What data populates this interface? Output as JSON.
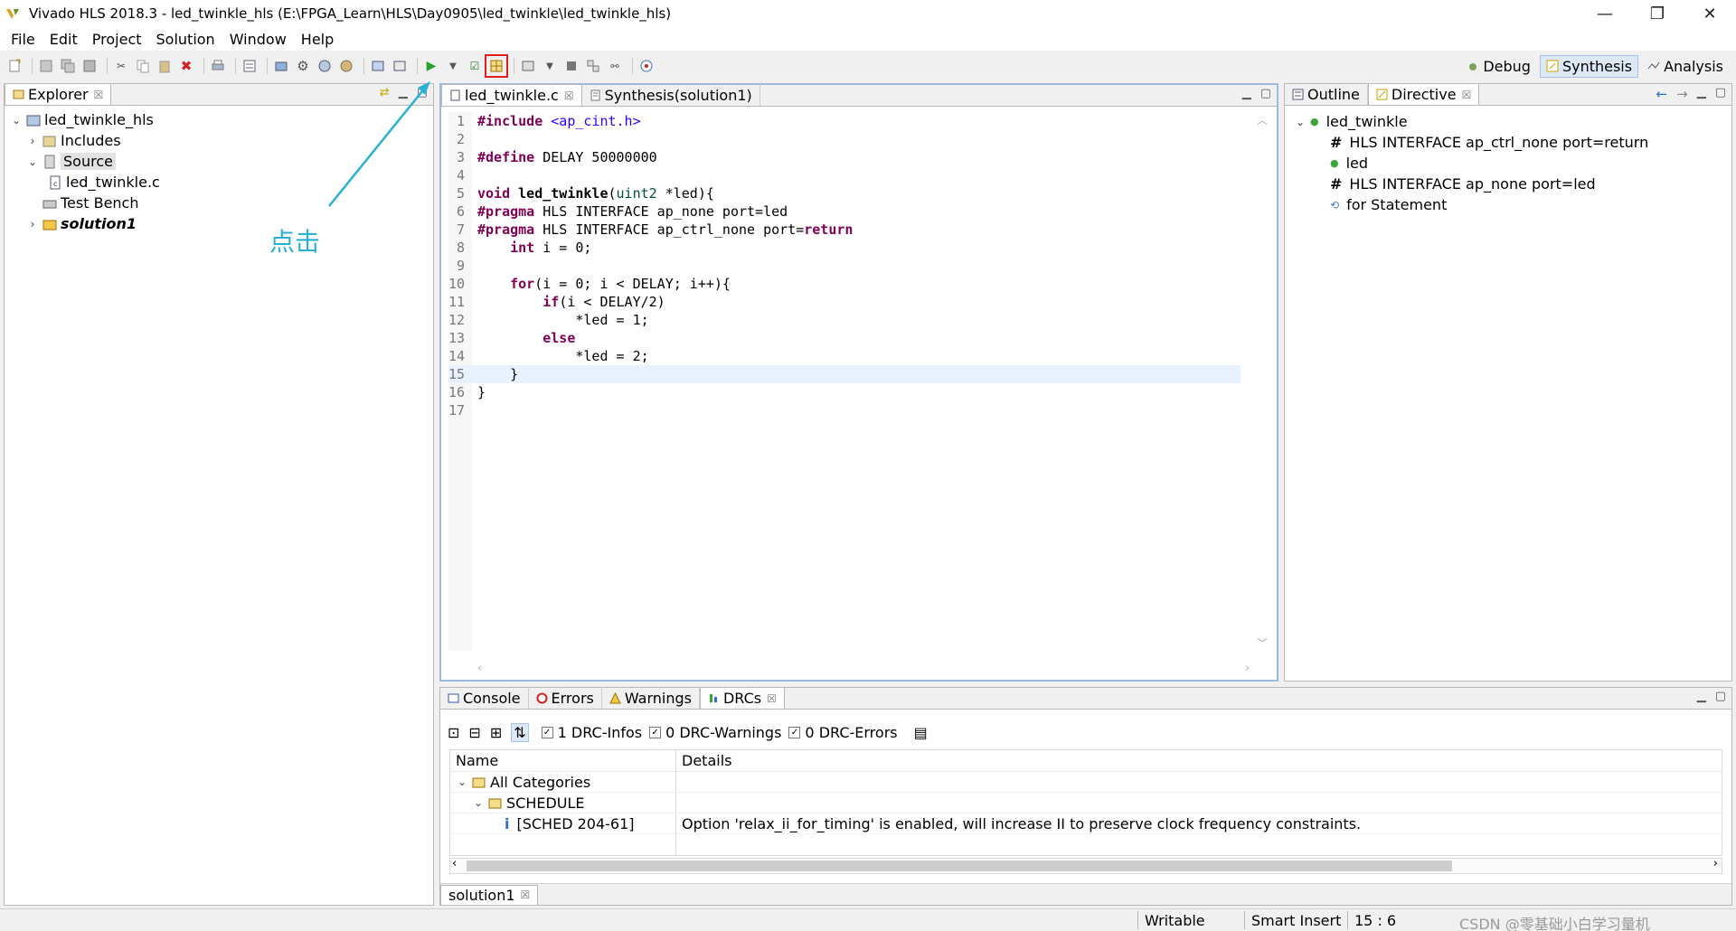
{
  "window": {
    "title": "Vivado HLS 2018.3 - led_twinkle_hls (E:\\FPGA_Learn\\HLS\\Day0905\\led_twinkle\\led_twinkle_hls)",
    "minimize": "—",
    "restore": "❐",
    "close": "✕"
  },
  "menu": [
    "File",
    "Edit",
    "Project",
    "Solution",
    "Window",
    "Help"
  ],
  "perspectives": {
    "debug": "Debug",
    "synthesis": "Synthesis",
    "analysis": "Analysis"
  },
  "explorer": {
    "tab": "Explorer",
    "project": "led_twinkle_hls",
    "includes": "Includes",
    "source": "Source",
    "source_file": "led_twinkle.c",
    "test_bench": "Test Bench",
    "solution": "solution1"
  },
  "annotation": "点击",
  "editor": {
    "tabs": [
      "led_twinkle.c",
      "Synthesis(solution1)"
    ],
    "current_line": 15
  },
  "code": [
    [
      {
        "t": "#include ",
        "c": "kw"
      },
      {
        "t": "<ap_cint.h>",
        "c": "inc"
      }
    ],
    [],
    [
      {
        "t": "#define ",
        "c": "kw"
      },
      {
        "t": "DELAY 50000000"
      }
    ],
    [],
    [
      {
        "t": "void ",
        "c": "kw"
      },
      {
        "t": "led_twinkle",
        "c": "b"
      },
      {
        "t": "("
      },
      {
        "t": "uint2",
        "c": "typ"
      },
      {
        "t": " *led){"
      }
    ],
    [
      {
        "t": "#pragma ",
        "c": "kw"
      },
      {
        "t": "HLS INTERFACE ap_none port=led"
      }
    ],
    [
      {
        "t": "#pragma ",
        "c": "kw"
      },
      {
        "t": "HLS INTERFACE ap_ctrl_none port="
      },
      {
        "t": "return",
        "c": "kw"
      }
    ],
    [
      {
        "t": "    "
      },
      {
        "t": "int",
        "c": "kw"
      },
      {
        "t": " i = 0;"
      }
    ],
    [],
    [
      {
        "t": "    "
      },
      {
        "t": "for",
        "c": "kw"
      },
      {
        "t": "(i = 0; i < DELAY; i++){"
      }
    ],
    [
      {
        "t": "        "
      },
      {
        "t": "if",
        "c": "kw"
      },
      {
        "t": "(i < DELAY/2)"
      }
    ],
    [
      {
        "t": "            *led = 1;"
      }
    ],
    [
      {
        "t": "        "
      },
      {
        "t": "else",
        "c": "kw"
      }
    ],
    [
      {
        "t": "            *led = 2;"
      }
    ],
    [
      {
        "t": "    }"
      }
    ],
    [
      {
        "t": "}"
      }
    ],
    []
  ],
  "outline": {
    "tabs": [
      "Outline",
      "Directive"
    ],
    "function": "led_twinkle",
    "items": [
      "HLS INTERFACE ap_ctrl_none port=return",
      "led",
      "HLS INTERFACE ap_none port=led",
      "for Statement"
    ]
  },
  "console": {
    "tabs": [
      "Console",
      "Errors",
      "Warnings",
      "DRCs"
    ],
    "drc_infos": "1 DRC-Infos",
    "drc_warnings": "0 DRC-Warnings",
    "drc_errors": "0 DRC-Errors",
    "col_name": "Name",
    "col_details": "Details",
    "all_categories": "All Categories",
    "schedule": "SCHEDULE",
    "msg_id": "[SCHED 204-61]",
    "msg_detail": "Option 'relax_ii_for_timing' is enabled, will increase II to preserve clock frequency constraints.",
    "bottom_tab": "solution1"
  },
  "status": {
    "writable": "Writable",
    "insert_mode": "Smart Insert",
    "position": "15 : 6",
    "watermark": "CSDN @零基础小白学习量机"
  }
}
